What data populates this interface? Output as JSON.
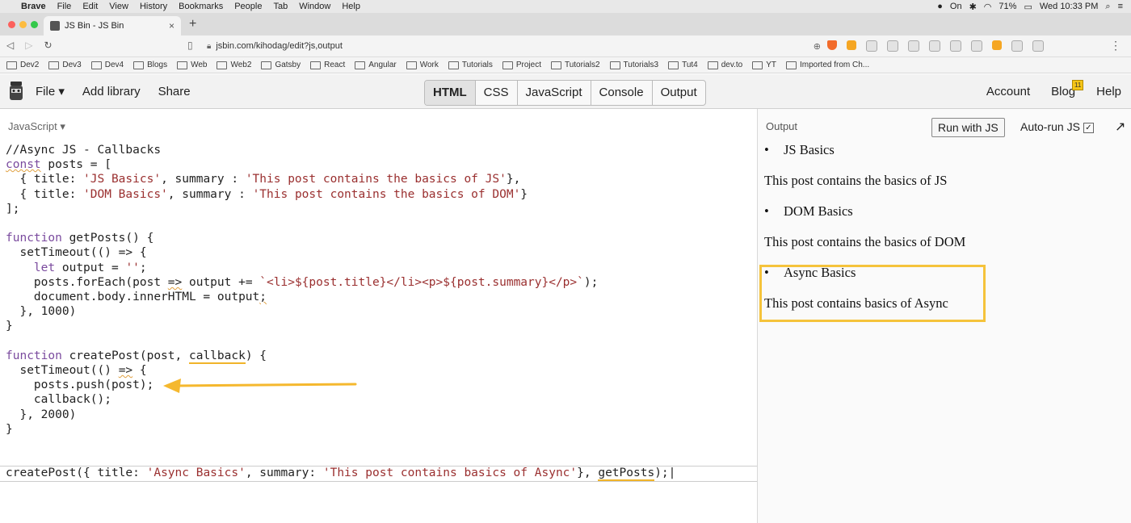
{
  "menubar": {
    "app": "Brave",
    "items": [
      "File",
      "Edit",
      "View",
      "History",
      "Bookmarks",
      "People",
      "Tab",
      "Window",
      "Help"
    ],
    "battery": "71%",
    "clock": "Wed 10:33 PM",
    "status_on": "On"
  },
  "tab": {
    "title": "JS Bin - JS Bin",
    "close": "×",
    "new": "+"
  },
  "address": {
    "url": "jsbin.com/kihodag/edit?js,output"
  },
  "bookmarks": [
    "Dev2",
    "Dev3",
    "Dev4",
    "Blogs",
    "Web",
    "Web2",
    "Gatsby",
    "React",
    "Angular",
    "Work",
    "Tutorials",
    "Project",
    "Tutorials2",
    "Tutorials3",
    "Tut4",
    "dev.to",
    "YT",
    "Imported from Ch..."
  ],
  "jsbin": {
    "file": "File",
    "add_library": "Add library",
    "share": "Share",
    "panels": [
      "HTML",
      "CSS",
      "JavaScript",
      "Console",
      "Output"
    ],
    "account": "Account",
    "blog": "Blog",
    "help": "Help",
    "blog_badge": "11"
  },
  "editor": {
    "label": "JavaScript"
  },
  "output": {
    "label": "Output",
    "run_button": "Run with JS",
    "autorun": "Auto-run JS",
    "items": [
      {
        "title": "JS Basics",
        "summary": "This post contains the basics of JS"
      },
      {
        "title": "DOM Basics",
        "summary": "This post contains the basics of DOM"
      },
      {
        "title": "Async Basics",
        "summary": "This post contains basics of Async"
      }
    ]
  },
  "colors": {
    "highlight": "#f5c33b",
    "arrow": "#f5b82e"
  }
}
